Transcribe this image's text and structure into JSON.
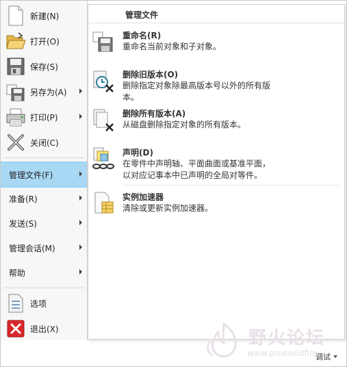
{
  "menu": {
    "items": [
      {
        "label": "新建(N)",
        "icon": "new-file-icon",
        "submenu": false
      },
      {
        "label": "打开(O)",
        "icon": "open-folder-icon",
        "submenu": false
      },
      {
        "label": "保存(S)",
        "icon": "save-icon",
        "submenu": false
      },
      {
        "label": "另存为(A)",
        "icon": "save-as-icon",
        "submenu": true
      },
      {
        "label": "打印(P)",
        "icon": "print-icon",
        "submenu": true
      },
      {
        "label": "关闭(C)",
        "icon": "close-icon",
        "submenu": false
      }
    ],
    "text_items": [
      {
        "label": "管理文件(F)",
        "submenu": true,
        "active": true
      },
      {
        "label": "准备(R)",
        "submenu": true
      },
      {
        "label": "发送(S)",
        "submenu": true
      },
      {
        "label": "管理会话(M)",
        "submenu": true
      },
      {
        "label": "帮助",
        "submenu": true
      }
    ],
    "bottom_items": [
      {
        "label": "选项",
        "icon": "options-icon"
      },
      {
        "label": "退出(X)",
        "icon": "exit-icon"
      }
    ]
  },
  "panel": {
    "title": "管理文件",
    "entries": [
      {
        "title": "重命名(R)",
        "description": "重命名当前对象和子对象。",
        "icon": "rename-icon"
      },
      {
        "title": "删除旧版本(O)",
        "description": "删除指定对象除最高版本号以外的所有版本。",
        "icon": "delete-old-versions-icon"
      },
      {
        "title": "删除所有版本(A)",
        "description": "从磁盘删除指定对象的所有版本。",
        "icon": "delete-all-versions-icon"
      },
      {
        "title": "声明(D)",
        "description": "在零件中声明轴、平面曲面或基准平面，以对应记事本中已声明的全局对等件。",
        "icon": "declare-icon"
      },
      {
        "title": "实例加速器",
        "description": "清除或更新实例加速器。",
        "icon": "instance-accelerator-icon"
      }
    ]
  },
  "watermark": {
    "text": "野火论坛",
    "url": "www.proewildfire"
  },
  "status": {
    "debug_label": "调试"
  }
}
